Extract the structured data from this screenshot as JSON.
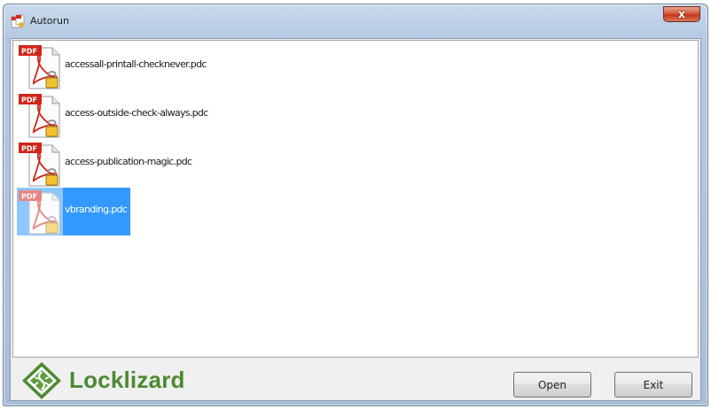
{
  "window": {
    "title": "Autorun",
    "close_label": "x"
  },
  "files": [
    {
      "name": "accessall-printall-checknever.pdc",
      "selected": false
    },
    {
      "name": "access-outside-check-always.pdc",
      "selected": false
    },
    {
      "name": "access-publication-magic.pdc",
      "selected": false
    },
    {
      "name": "vbranding.pdc",
      "selected": true
    }
  ],
  "file_icon_badge": "PDF",
  "footer": {
    "logo_text": "Locklizard",
    "open_label": "Open",
    "exit_label": "Exit"
  },
  "colors": {
    "selection": "#3399ff",
    "logo_green": "#4c8a33",
    "pdf_red": "#d0251a"
  }
}
